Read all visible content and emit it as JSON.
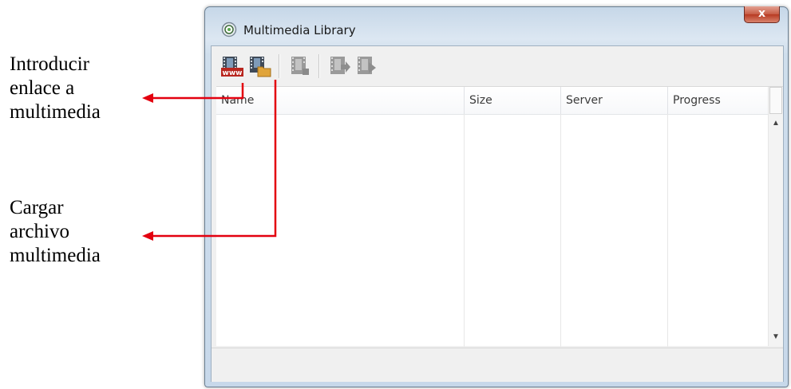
{
  "annotations": {
    "link": [
      "Introducir",
      "enlace a",
      "multimedia"
    ],
    "file": [
      "Cargar",
      "archivo",
      "multimedia"
    ]
  },
  "window": {
    "title": "Multimedia Library",
    "close_label": "x"
  },
  "toolbar": {
    "buttons": [
      {
        "icon": "film-www-icon",
        "enabled": true
      },
      {
        "icon": "film-folder-icon",
        "enabled": true
      },
      {
        "icon": "film-edit-icon",
        "enabled": false
      },
      {
        "icon": "film-export-icon",
        "enabled": false
      },
      {
        "icon": "film-play-icon",
        "enabled": false
      }
    ]
  },
  "table": {
    "columns": [
      "Name",
      "Size",
      "Server",
      "Progress"
    ],
    "rows": []
  },
  "colors": {
    "arrow": "#e3000f",
    "title_bar": "#c6d7e8",
    "close_button": "#c75a43"
  }
}
